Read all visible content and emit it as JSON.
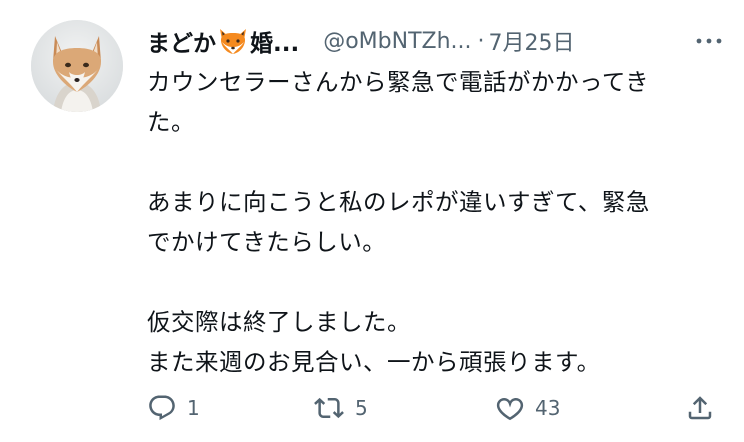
{
  "author": {
    "display_name": "まどか",
    "display_name_suffix": "婚...",
    "name_emoji": "fox-emoji",
    "handle": "@oMbNTZh...",
    "separator": "·",
    "date": "7月25日"
  },
  "tweet": {
    "lines": [
      "カウンセラーさんから緊急で電話がかかってき",
      "た。",
      "",
      "あまりに向こうと私のレポが違いすぎて、緊急",
      "でかけてきたらしい。",
      "",
      "仮交際は終了しました。",
      "また来週のお見合い、一から頑張ります。"
    ]
  },
  "actions": {
    "reply_count": "1",
    "retweet_count": "5",
    "like_count": "43"
  },
  "icons": {
    "reply": "reply-icon",
    "retweet": "retweet-icon",
    "like": "like-icon",
    "share": "share-icon",
    "more": "more-icon"
  },
  "colors": {
    "text": "#0f1419",
    "secondary": "#536471",
    "fox_orange": "#f58a1f"
  }
}
